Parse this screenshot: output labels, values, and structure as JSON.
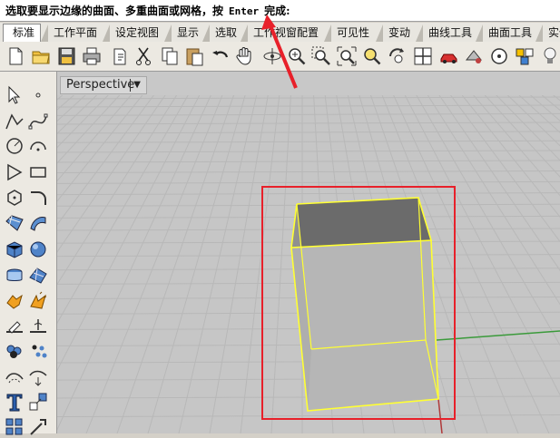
{
  "command_prompt": {
    "text_before": "选取要显示边缘的曲面、多重曲面或网格，按",
    "key": "Enter",
    "text_after": "完成:"
  },
  "tabs": [
    {
      "label": "标准",
      "active": true
    },
    {
      "label": "工作平面"
    },
    {
      "label": "设定视图"
    },
    {
      "label": "显示"
    },
    {
      "label": "选取"
    },
    {
      "label": "工作视窗配置"
    },
    {
      "label": "可见性"
    },
    {
      "label": "变动"
    },
    {
      "label": "曲线工具"
    },
    {
      "label": "曲面工具"
    },
    {
      "label": "实体"
    }
  ],
  "toolbar_icons": [
    "new-file-icon",
    "open-folder-icon",
    "save-icon",
    "print-icon",
    "import-icon",
    "cut-icon",
    "copy-icon",
    "paste-icon",
    "undo-icon",
    "pan-hand-icon",
    "rotate-view-icon",
    "zoom-in-icon",
    "zoom-window-icon",
    "zoom-extents-icon",
    "zoom-selected-icon",
    "rotate-camera-icon",
    "four-viewports-icon",
    "car-render-icon",
    "material-icon",
    "circle-snap-icon",
    "object-properties-icon",
    "lightbulb-icon"
  ],
  "left_tools": [
    "select-arrow-icon",
    "point-icon",
    "polyline-icon",
    "curve-icon",
    "circle-icon",
    "arc-icon",
    "polygon-icon",
    "rectangle-icon",
    "polygon-star-icon",
    "fillet-curve-icon",
    "surface-patch-icon",
    "sweep-surface-icon",
    "box-solid-icon",
    "sphere-solid-icon",
    "extrude-icon",
    "mesh-icon",
    "boolean-icon",
    "explode-icon",
    "split-icon",
    "trim-icon",
    "group-icon",
    "point-cloud-icon",
    "offset-icon",
    "dimension-icon",
    "text-icon",
    "scale-icon",
    "array-icon",
    "transform-icon"
  ],
  "viewport": {
    "label": "Perspective",
    "caret": "▼"
  },
  "colors": {
    "selection_wire": "#ffff33",
    "annotation_red": "#e8202a",
    "grid": "#b8b8b8",
    "x_axis": "#c04040",
    "y_axis": "#40a040"
  }
}
